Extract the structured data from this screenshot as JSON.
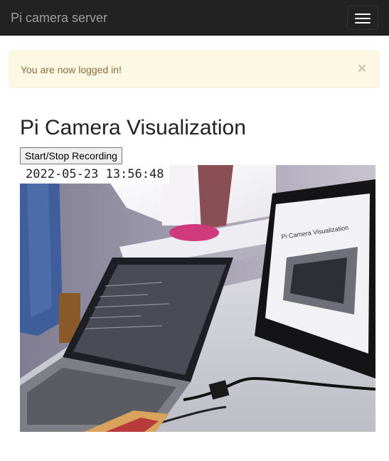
{
  "navbar": {
    "brand": "Pi camera server",
    "menu_icon": "hamburger-menu-icon"
  },
  "alert": {
    "message": "You are now logged in!",
    "close_symbol": "×"
  },
  "main": {
    "title": "Pi Camera Visualization",
    "record_button_label": "Start/Stop Recording",
    "camera_feed": {
      "timestamp": "2022-05-23 13:56:48",
      "screen_title": "Pi Camera Visualization"
    }
  },
  "colors": {
    "navbar_bg": "#222222",
    "brand_text": "#9d9d9d",
    "alert_bg": "#fcf8e3",
    "alert_text": "#8a6d3b"
  }
}
